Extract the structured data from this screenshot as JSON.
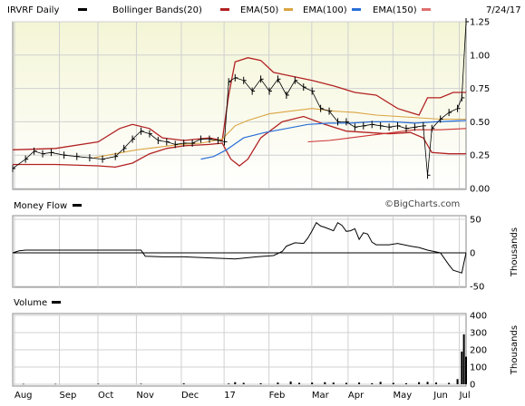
{
  "header": {
    "symbol_label": "IRVRF Daily",
    "bollinger_label": "Bollinger Bands(20)",
    "ema50_label": "EMA(50)",
    "ema100_label": "EMA(100)",
    "ema150_label": "EMA(150)",
    "date_label": "7/24/17"
  },
  "colors": {
    "price": "#000000",
    "bollinger": "#b22222",
    "ema50": "#cc3333",
    "ema100": "#d9a441",
    "ema150": "#2a6fd6",
    "background_top": "#f4f5d6",
    "background_bottom": "#ffffff",
    "grid": "#d0d0d0"
  },
  "watermark": "©BigCharts.com",
  "chart_data": [
    {
      "type": "line",
      "panel": "price",
      "ylim": [
        0,
        1.25
      ],
      "y_ticks": [
        "1.25",
        "1.00",
        "0.75",
        "0.50",
        "0.25",
        "0.00"
      ],
      "x_ticks": [
        "Aug",
        "Sep",
        "Oct",
        "Nov",
        "Dec",
        "17",
        "Feb",
        "Mar",
        "Apr",
        "May",
        "Jun",
        "Jul"
      ],
      "series": [
        {
          "name": "IRVRF Daily",
          "values": [
            [
              0,
              0.15
            ],
            [
              6,
              0.22
            ],
            [
              10,
              0.28
            ],
            [
              14,
              0.26
            ],
            [
              18,
              0.27
            ],
            [
              24,
              0.25
            ],
            [
              30,
              0.24
            ],
            [
              36,
              0.23
            ],
            [
              42,
              0.22
            ],
            [
              48,
              0.24
            ],
            [
              52,
              0.3
            ],
            [
              56,
              0.37
            ],
            [
              60,
              0.43
            ],
            [
              64,
              0.41
            ],
            [
              68,
              0.36
            ],
            [
              72,
              0.35
            ],
            [
              76,
              0.33
            ],
            [
              80,
              0.34
            ],
            [
              84,
              0.34
            ],
            [
              88,
              0.37
            ],
            [
              92,
              0.37
            ],
            [
              96,
              0.36
            ],
            [
              99,
              0.35
            ],
            [
              101,
              0.8
            ],
            [
              104,
              0.83
            ],
            [
              108,
              0.81
            ],
            [
              112,
              0.73
            ],
            [
              116,
              0.82
            ],
            [
              120,
              0.73
            ],
            [
              124,
              0.82
            ],
            [
              128,
              0.7
            ],
            [
              132,
              0.81
            ],
            [
              136,
              0.76
            ],
            [
              140,
              0.73
            ],
            [
              144,
              0.6
            ],
            [
              148,
              0.58
            ],
            [
              152,
              0.5
            ],
            [
              156,
              0.5
            ],
            [
              160,
              0.46
            ],
            [
              164,
              0.47
            ],
            [
              168,
              0.48
            ],
            [
              172,
              0.47
            ],
            [
              176,
              0.46
            ],
            [
              180,
              0.47
            ],
            [
              184,
              0.45
            ],
            [
              188,
              0.46
            ],
            [
              192,
              0.47
            ],
            [
              194,
              0.1
            ],
            [
              196,
              0.45
            ],
            [
              200,
              0.52
            ],
            [
              204,
              0.57
            ],
            [
              208,
              0.6
            ],
            [
              210,
              0.68
            ],
            [
              212,
              1.25
            ]
          ]
        },
        {
          "name": "Bollinger Bands(20)",
          "upper": [
            [
              0,
              0.29
            ],
            [
              20,
              0.3
            ],
            [
              40,
              0.35
            ],
            [
              50,
              0.45
            ],
            [
              56,
              0.48
            ],
            [
              64,
              0.45
            ],
            [
              70,
              0.38
            ],
            [
              80,
              0.36
            ],
            [
              92,
              0.38
            ],
            [
              98,
              0.36
            ],
            [
              101,
              0.7
            ],
            [
              104,
              0.95
            ],
            [
              110,
              0.98
            ],
            [
              116,
              0.96
            ],
            [
              122,
              0.87
            ],
            [
              128,
              0.85
            ],
            [
              140,
              0.81
            ],
            [
              150,
              0.77
            ],
            [
              160,
              0.72
            ],
            [
              170,
              0.7
            ],
            [
              180,
              0.6
            ],
            [
              186,
              0.57
            ],
            [
              190,
              0.55
            ],
            [
              194,
              0.68
            ],
            [
              200,
              0.68
            ],
            [
              206,
              0.72
            ],
            [
              212,
              0.72
            ]
          ],
          "lower": [
            [
              0,
              0.18
            ],
            [
              20,
              0.18
            ],
            [
              40,
              0.17
            ],
            [
              48,
              0.16
            ],
            [
              56,
              0.19
            ],
            [
              64,
              0.26
            ],
            [
              72,
              0.3
            ],
            [
              80,
              0.32
            ],
            [
              92,
              0.33
            ],
            [
              98,
              0.34
            ],
            [
              102,
              0.22
            ],
            [
              106,
              0.17
            ],
            [
              110,
              0.22
            ],
            [
              116,
              0.38
            ],
            [
              126,
              0.5
            ],
            [
              136,
              0.54
            ],
            [
              146,
              0.48
            ],
            [
              156,
              0.43
            ],
            [
              166,
              0.42
            ],
            [
              176,
              0.41
            ],
            [
              186,
              0.42
            ],
            [
              192,
              0.38
            ],
            [
              196,
              0.27
            ],
            [
              204,
              0.26
            ],
            [
              212,
              0.26
            ]
          ]
        },
        {
          "name": "EMA(50)",
          "values": [
            [
              138,
              0.35
            ],
            [
              148,
              0.36
            ],
            [
              158,
              0.38
            ],
            [
              168,
              0.4
            ],
            [
              178,
              0.42
            ],
            [
              188,
              0.44
            ],
            [
              200,
              0.44
            ],
            [
              212,
              0.45
            ]
          ]
        },
        {
          "name": "EMA(100)",
          "values": [
            [
              38,
              0.23
            ],
            [
              48,
              0.26
            ],
            [
              58,
              0.29
            ],
            [
              68,
              0.31
            ],
            [
              78,
              0.33
            ],
            [
              88,
              0.34
            ],
            [
              98,
              0.37
            ],
            [
              104,
              0.47
            ],
            [
              110,
              0.51
            ],
            [
              120,
              0.56
            ],
            [
              130,
              0.58
            ],
            [
              140,
              0.6
            ],
            [
              150,
              0.58
            ],
            [
              160,
              0.57
            ],
            [
              170,
              0.55
            ],
            [
              180,
              0.54
            ],
            [
              190,
              0.53
            ],
            [
              200,
              0.52
            ],
            [
              212,
              0.52
            ]
          ]
        },
        {
          "name": "EMA(150)",
          "values": [
            [
              88,
              0.22
            ],
            [
              94,
              0.24
            ],
            [
              100,
              0.29
            ],
            [
              108,
              0.38
            ],
            [
              118,
              0.42
            ],
            [
              128,
              0.45
            ],
            [
              138,
              0.48
            ],
            [
              148,
              0.49
            ],
            [
              158,
              0.49
            ],
            [
              168,
              0.5
            ],
            [
              178,
              0.5
            ],
            [
              188,
              0.49
            ],
            [
              198,
              0.5
            ],
            [
              212,
              0.51
            ]
          ]
        }
      ]
    },
    {
      "type": "line",
      "panel": "money_flow",
      "title": "Money Flow",
      "ylim": [
        -50,
        50
      ],
      "y_ticks": [
        "50",
        "0",
        "-50"
      ],
      "ylabel": "Thousands",
      "series": [
        {
          "name": "Money Flow",
          "values": [
            [
              0,
              0
            ],
            [
              3,
              3
            ],
            [
              6,
              4
            ],
            [
              40,
              4
            ],
            [
              60,
              4
            ],
            [
              62,
              -5
            ],
            [
              70,
              -6
            ],
            [
              80,
              -6
            ],
            [
              95,
              -8
            ],
            [
              104,
              -9
            ],
            [
              114,
              -6
            ],
            [
              122,
              -4
            ],
            [
              126,
              2
            ],
            [
              128,
              10
            ],
            [
              132,
              15
            ],
            [
              136,
              14
            ],
            [
              138,
              22
            ],
            [
              140,
              33
            ],
            [
              142,
              45
            ],
            [
              144,
              40
            ],
            [
              146,
              38
            ],
            [
              150,
              33
            ],
            [
              152,
              45
            ],
            [
              154,
              41
            ],
            [
              156,
              32
            ],
            [
              158,
              33
            ],
            [
              160,
              36
            ],
            [
              162,
              20
            ],
            [
              164,
              30
            ],
            [
              166,
              28
            ],
            [
              168,
              16
            ],
            [
              170,
              12
            ],
            [
              176,
              12
            ],
            [
              180,
              14
            ],
            [
              186,
              10
            ],
            [
              190,
              8
            ],
            [
              194,
              4
            ],
            [
              200,
              0
            ],
            [
              204,
              -18
            ],
            [
              206,
              -26
            ],
            [
              208,
              -28
            ],
            [
              210,
              -30
            ],
            [
              211,
              -15
            ],
            [
              212,
              0
            ]
          ]
        }
      ]
    },
    {
      "type": "bar",
      "panel": "volume",
      "title": "Volume",
      "ylim": [
        0,
        400
      ],
      "y_ticks": [
        "400",
        "300",
        "200",
        "100",
        "0"
      ],
      "ylabel": "Thousands",
      "series": [
        {
          "name": "Volume",
          "values": [
            [
              5,
              2
            ],
            [
              20,
              2
            ],
            [
              40,
              3
            ],
            [
              60,
              3
            ],
            [
              80,
              5
            ],
            [
              101,
              4
            ],
            [
              104,
              12
            ],
            [
              108,
              8
            ],
            [
              116,
              6
            ],
            [
              124,
              10
            ],
            [
              130,
              16
            ],
            [
              134,
              8
            ],
            [
              140,
              10
            ],
            [
              146,
              12
            ],
            [
              150,
              10
            ],
            [
              156,
              8
            ],
            [
              162,
              10
            ],
            [
              168,
              6
            ],
            [
              172,
              14
            ],
            [
              178,
              8
            ],
            [
              184,
              6
            ],
            [
              190,
              12
            ],
            [
              194,
              14
            ],
            [
              198,
              10
            ],
            [
              204,
              8
            ],
            [
              208,
              30
            ],
            [
              210,
              190
            ],
            [
              211,
              290
            ],
            [
              212,
              160
            ]
          ]
        }
      ]
    }
  ]
}
